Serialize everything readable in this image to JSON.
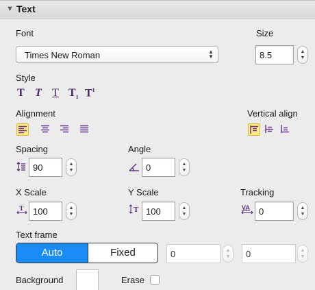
{
  "header": {
    "toggle_icon": "▼",
    "title": "Text"
  },
  "font": {
    "label": "Font",
    "value": "Times New Roman"
  },
  "size": {
    "label": "Size",
    "value": "8.5"
  },
  "style": {
    "label": "Style",
    "buttons": [
      {
        "name": "bold",
        "glyph": "T"
      },
      {
        "name": "italic",
        "glyph": "T"
      },
      {
        "name": "underline",
        "glyph": "T"
      },
      {
        "name": "subscript",
        "glyph": "T",
        "mark": "1"
      },
      {
        "name": "superscript",
        "glyph": "T",
        "mark": "1"
      }
    ]
  },
  "alignment": {
    "label": "Alignment",
    "selected": "left"
  },
  "vertical_align": {
    "label": "Vertical align",
    "selected": "top"
  },
  "spacing": {
    "label": "Spacing",
    "value": "90"
  },
  "angle": {
    "label": "Angle",
    "value": "0"
  },
  "x_scale": {
    "label": "X Scale",
    "value": "100"
  },
  "y_scale": {
    "label": "Y Scale",
    "value": "100"
  },
  "tracking": {
    "label": "Tracking",
    "value": "0",
    "icon_text": "VA"
  },
  "text_frame": {
    "label": "Text frame",
    "options": [
      "Auto",
      "Fixed"
    ],
    "selected": "Auto",
    "width_value": "0",
    "height_value": "0"
  },
  "background": {
    "label": "Background",
    "color": "#ffffff"
  },
  "erase": {
    "label": "Erase",
    "checked": false
  },
  "colors": {
    "accent": "#1b8cf5",
    "highlight": "#ffe98a",
    "icon": "#5b2e7a"
  }
}
